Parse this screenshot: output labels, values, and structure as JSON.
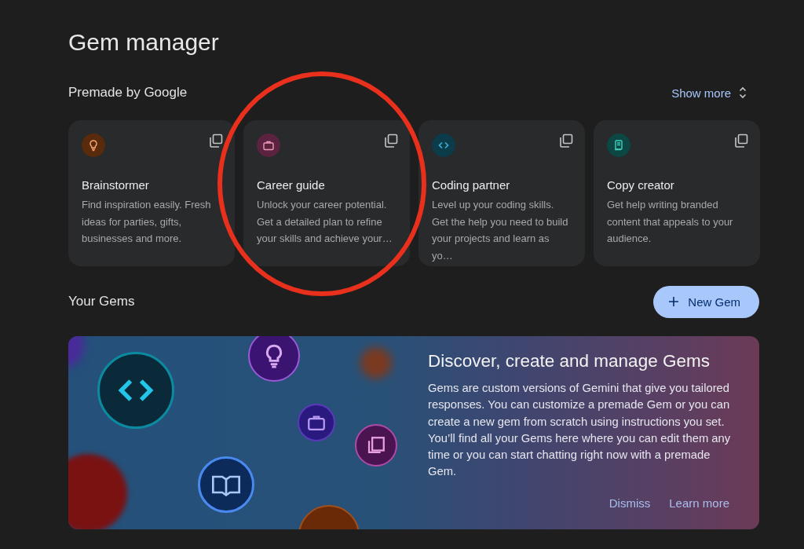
{
  "page": {
    "title": "Gem manager"
  },
  "premade": {
    "heading": "Premade by Google",
    "show_more": "Show more",
    "cards": [
      {
        "kind": "bulb",
        "color": "#5a2a0c",
        "title": "Brainstormer",
        "description": "Find inspiration easily. Fresh ideas for parties, gifts, businesses and more."
      },
      {
        "kind": "briefcase",
        "color": "#5c2340",
        "title": "Career guide",
        "description": "Unlock your career potential. Get a detailed plan to refine your skills and achieve your…"
      },
      {
        "kind": "code",
        "color": "#0c3b4a",
        "title": "Coding partner",
        "description": "Level up your coding skills. Get the help you need to build your projects and learn as yo…"
      },
      {
        "kind": "document",
        "color": "#0d4744",
        "title": "Copy creator",
        "description": "Get help writing branded content that appeals to your audience."
      }
    ]
  },
  "your_gems": {
    "heading": "Your Gems",
    "new_button": "New Gem"
  },
  "banner": {
    "title": "Discover, create and manage Gems",
    "body": "Gems are custom versions of Gemini that give you tailored responses. You can customize a premade Gem or you can create a new gem from scratch using instructions you set. You’ll find all your Gems here where you can edit them any time or you can start chatting right now with a premade Gem.",
    "actions": [
      "Dismiss",
      "Learn more"
    ]
  }
}
